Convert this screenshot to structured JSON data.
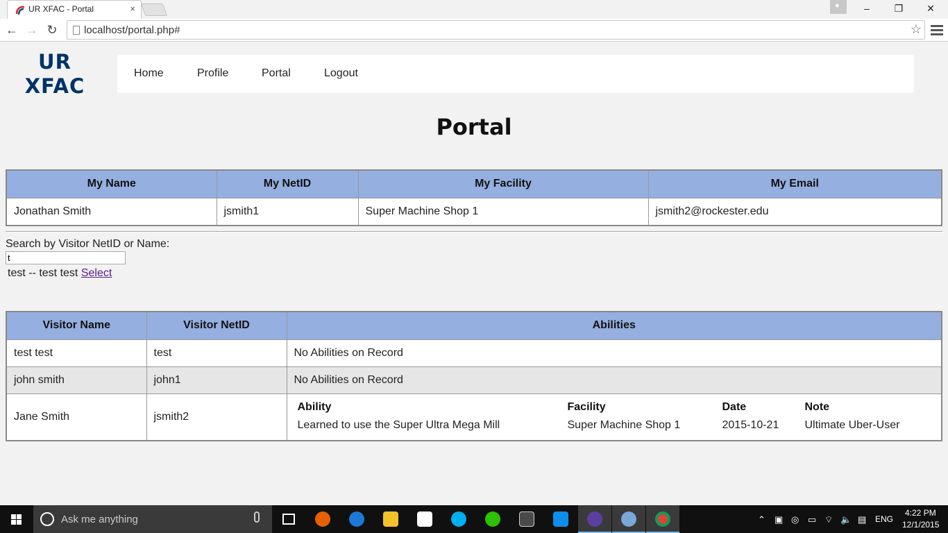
{
  "browser": {
    "tab_title": "UR XFAC - Portal",
    "tab_close": "×",
    "url": "localhost/portal.php#",
    "window_buttons": [
      "–",
      "❐",
      "✕"
    ]
  },
  "site": {
    "logo_line1": "UR",
    "logo_line2": "XFAC",
    "nav": [
      "Home",
      "Profile",
      "Portal",
      "Logout"
    ]
  },
  "page_title": "Portal",
  "my_info": {
    "headers": [
      "My Name",
      "My NetID",
      "My Facility",
      "My Email"
    ],
    "row": [
      "Jonathan Smith",
      "jsmith1",
      "Super Machine Shop 1",
      "jsmith2@rockester.edu"
    ]
  },
  "search": {
    "label": "Search by Visitor NetID or Name:",
    "value": "t",
    "result_text": "test -- test test ",
    "result_link": "Select"
  },
  "visitors": {
    "headers": [
      "Visitor Name",
      "Visitor NetID",
      "Abilities"
    ],
    "rows": [
      {
        "name": "test test",
        "netid": "test",
        "abilities": "No Abilities on Record"
      },
      {
        "name": "john smith",
        "netid": "john1",
        "abilities": "No Abilities on Record"
      },
      {
        "name": "Jane Smith",
        "netid": "jsmith2"
      }
    ],
    "ability_headers": [
      "Ability",
      "Facility",
      "Date",
      "Note"
    ],
    "ability_row": [
      "Learned to use the Super Ultra Mega Mill",
      "Super Machine Shop 1",
      "2015-10-21",
      "Ultimate Uber-User"
    ]
  },
  "taskbar": {
    "search_placeholder": "Ask me anything",
    "lang": "ENG",
    "time": "4:22 PM",
    "date": "12/1/2015",
    "apps": [
      "task-view",
      "firefox",
      "edge",
      "file-explorer",
      "store",
      "skype",
      "wechat",
      "terminal",
      "teamviewer",
      "app-purple",
      "paint",
      "chrome"
    ],
    "app_colors": {
      "firefox": "#e66000",
      "edge": "#1e78d6",
      "file-explorer": "#f3c12a",
      "store": "#ffffff",
      "skype": "#00aff0",
      "wechat": "#2dc100",
      "terminal": "#4a4a4a",
      "teamviewer": "#0e8ee9",
      "app-purple": "#5b3fa0",
      "paint": "#7aa6d8",
      "chrome": "#db4437"
    }
  }
}
